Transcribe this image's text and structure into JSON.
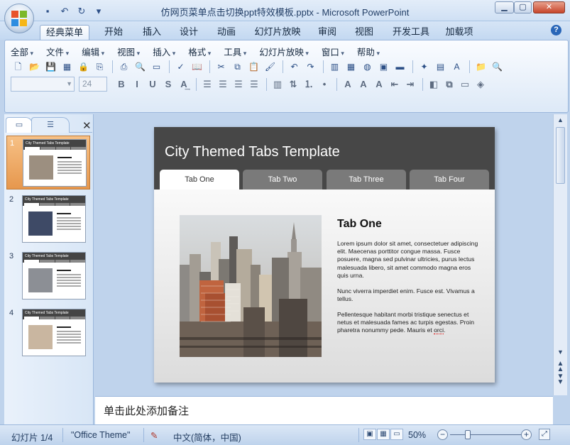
{
  "window": {
    "title": "仿网页菜单点击切换ppt特效模板.pptx - Microsoft PowerPoint",
    "buttons": {
      "minimize": "▁",
      "maximize": "▢",
      "close": "✕"
    }
  },
  "quick_access": [
    {
      "icon": "save-icon",
      "glyph": "▪"
    },
    {
      "icon": "undo-icon",
      "glyph": "↶"
    },
    {
      "icon": "redo-icon",
      "glyph": "↻"
    },
    {
      "icon": "customize-qat-icon",
      "glyph": "▾"
    }
  ],
  "ribbon_tabs": [
    {
      "label": "经典菜单",
      "active": true
    },
    {
      "label": "开始",
      "active": false
    },
    {
      "label": "插入",
      "active": false
    },
    {
      "label": "设计",
      "active": false
    },
    {
      "label": "动画",
      "active": false
    },
    {
      "label": "幻灯片放映",
      "active": false
    },
    {
      "label": "审阅",
      "active": false
    },
    {
      "label": "视图",
      "active": false
    },
    {
      "label": "开发工具",
      "active": false
    },
    {
      "label": "加载项",
      "active": false
    }
  ],
  "help": {
    "glyph": "?"
  },
  "classic_menu": [
    "全部",
    "文件",
    "编辑",
    "视图",
    "插入",
    "格式",
    "工具",
    "幻灯片放映",
    "窗口",
    "帮助"
  ],
  "toolbar_row1": [
    {
      "icon": "new-icon",
      "glyph": "🗋"
    },
    {
      "icon": "open-icon",
      "glyph": "📂"
    },
    {
      "icon": "save-icon",
      "glyph": "💾"
    },
    {
      "icon": "save-pdf-icon",
      "glyph": "▦"
    },
    {
      "icon": "permission-icon",
      "glyph": "🔒"
    },
    {
      "icon": "attach-icon",
      "glyph": "⎘"
    },
    {
      "sep": true
    },
    {
      "icon": "print-icon",
      "glyph": "⎙"
    },
    {
      "icon": "print-preview-icon",
      "glyph": "🔍"
    },
    {
      "icon": "slide-view-icon",
      "glyph": "▭"
    },
    {
      "sep": true
    },
    {
      "icon": "spelling-icon",
      "glyph": "✓"
    },
    {
      "icon": "research-icon",
      "glyph": "📖"
    },
    {
      "sep": true
    },
    {
      "icon": "cut-icon",
      "glyph": "✂"
    },
    {
      "icon": "copy-icon",
      "glyph": "⧉"
    },
    {
      "icon": "paste-icon",
      "glyph": "📋"
    },
    {
      "icon": "format-painter-icon",
      "glyph": "🖌"
    },
    {
      "sep": true
    },
    {
      "icon": "undo-icon",
      "glyph": "↶"
    },
    {
      "icon": "redo-icon",
      "glyph": "↷"
    },
    {
      "sep": true
    },
    {
      "icon": "chart-icon",
      "glyph": "▥"
    },
    {
      "icon": "table-icon",
      "glyph": "▦"
    },
    {
      "icon": "clipart-icon",
      "glyph": "◍"
    },
    {
      "icon": "picture-icon",
      "glyph": "▣"
    },
    {
      "icon": "fill-color-icon",
      "glyph": "▬"
    },
    {
      "sep": true
    },
    {
      "icon": "new-slide-icon",
      "glyph": "✦"
    },
    {
      "icon": "layout-icon",
      "glyph": "▤"
    },
    {
      "icon": "textbox-icon",
      "glyph": "A"
    },
    {
      "sep": true
    },
    {
      "icon": "folder-icon",
      "glyph": "📁"
    },
    {
      "icon": "find-icon",
      "glyph": "🔍"
    }
  ],
  "font": {
    "name": "",
    "size": "24"
  },
  "format_buttons": [
    {
      "icon": "bold-icon",
      "glyph": "B"
    },
    {
      "icon": "italic-icon",
      "glyph": "I"
    },
    {
      "icon": "underline-icon",
      "glyph": "U"
    },
    {
      "icon": "shadow-icon",
      "glyph": "S"
    },
    {
      "icon": "char-spacing-icon",
      "glyph": "A͢"
    },
    {
      "sep": true
    },
    {
      "icon": "align-left-icon",
      "glyph": "☰"
    },
    {
      "icon": "align-center-icon",
      "glyph": "☰"
    },
    {
      "icon": "align-right-icon",
      "glyph": "☰"
    },
    {
      "icon": "justify-icon",
      "glyph": "☰"
    },
    {
      "sep": true
    },
    {
      "icon": "columns-icon",
      "glyph": "▥"
    },
    {
      "icon": "text-direction-icon",
      "glyph": "⇅"
    },
    {
      "icon": "numbering-icon",
      "glyph": "⒈"
    },
    {
      "icon": "bullets-icon",
      "glyph": "•"
    },
    {
      "sep": true
    },
    {
      "icon": "font-color-icon",
      "glyph": "A"
    },
    {
      "icon": "grow-font-icon",
      "glyph": "A"
    },
    {
      "icon": "shrink-font-icon",
      "glyph": "A"
    },
    {
      "icon": "decrease-indent-icon",
      "glyph": "⇤"
    },
    {
      "icon": "increase-indent-icon",
      "glyph": "⇥"
    },
    {
      "sep": true
    },
    {
      "icon": "shapes-icon",
      "glyph": "◧"
    },
    {
      "icon": "arrange-icon",
      "glyph": "⧉"
    },
    {
      "icon": "quick-styles-icon",
      "glyph": "▭"
    },
    {
      "icon": "shape-fill-icon",
      "glyph": "◈"
    }
  ],
  "panel": {
    "tabs": [
      {
        "icon": "slides-tab-icon",
        "glyph": "▭"
      },
      {
        "icon": "outline-tab-icon",
        "glyph": "☰"
      }
    ],
    "close": "✕"
  },
  "thumbnails": [
    {
      "number": "1",
      "title": "City Themed Tabs Template",
      "selected": true,
      "photo": "city"
    },
    {
      "number": "2",
      "title": "City Themed Tabs Template",
      "selected": false,
      "photo": "bridge"
    },
    {
      "number": "3",
      "title": "City Themed Tabs Template",
      "selected": false,
      "photo": "aerial"
    },
    {
      "number": "4",
      "title": "City Themed Tabs Template",
      "selected": false,
      "photo": "haze"
    }
  ],
  "slide": {
    "title": "City Themed Tabs Template",
    "tabs": [
      "Tab One",
      "Tab Two",
      "Tab Three",
      "Tab Four"
    ],
    "active_tab": 0,
    "heading": "Tab One",
    "para1": "Lorem ipsum dolor sit amet, consectetuer adipiscing elit. Maecenas porttitor congue massa. Fusce posuere, magna sed pulvinar ultricies, purus lectus malesuada libero, sit amet commodo magna eros quis urna.",
    "para2": "Nunc viverra imperdiet enim. Fusce est. Vivamus a tellus.",
    "para3_main": "Pellentesque habitant morbi tristique senectus et netus et malesuada fames ac turpis egestas. Proin pharetra nonummy pede. Mauris et ",
    "para3_flag": "orci",
    "para3_end": "."
  },
  "notes": {
    "placeholder": "单击此处添加备注"
  },
  "status": {
    "slide_counter": "幻灯片 1/4",
    "theme": "\"Office Theme\"",
    "language": "中文(简体，中国)",
    "zoom": "50%",
    "zoom_level": 0.5
  },
  "colors": {
    "accent_tab": "#e6974d",
    "slide_header": "#474747"
  }
}
